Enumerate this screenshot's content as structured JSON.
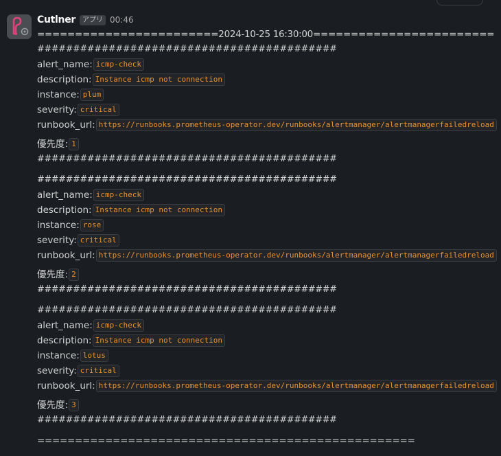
{
  "message": {
    "sender": "Cutlner",
    "app_tag": "アプリ",
    "time": "00:46",
    "top_separator": "========================2024-10-25 16:30:00========================",
    "hash_line": "##########################################",
    "bottom_separator": "==================================================",
    "alerts": [
      {
        "alert_name_label": "alert_name:",
        "alert_name": "icmp-check",
        "description_label": "description:",
        "description": "Instance icmp not connection",
        "instance_label": "instance:",
        "instance": "plum",
        "severity_label": "severity:",
        "severity": "critical",
        "runbook_label": "runbook_url:",
        "runbook_url": "https://runbooks.prometheus-operator.dev/runbooks/alertmanager/alertmanagerfailedreload",
        "priority_label": "優先度:",
        "priority": "1"
      },
      {
        "alert_name_label": "alert_name:",
        "alert_name": "icmp-check",
        "description_label": "description:",
        "description": "Instance icmp not connection",
        "instance_label": "instance:",
        "instance": "rose",
        "severity_label": "severity:",
        "severity": "critical",
        "runbook_label": "runbook_url:",
        "runbook_url": "https://runbooks.prometheus-operator.dev/runbooks/alertmanager/alertmanagerfailedreload",
        "priority_label": "優先度:",
        "priority": "2"
      },
      {
        "alert_name_label": "alert_name:",
        "alert_name": "icmp-check",
        "description_label": "description:",
        "description": "Instance icmp not connection",
        "instance_label": "instance:",
        "instance": "lotus",
        "severity_label": "severity:",
        "severity": "critical",
        "runbook_label": "runbook_url:",
        "runbook_url": "https://runbooks.prometheus-operator.dev/runbooks/alertmanager/alertmanagerfailedreload",
        "priority_label": "優先度:",
        "priority": "3"
      }
    ]
  },
  "colors": {
    "background": "#1a1d21",
    "code_text": "#e8912d",
    "text": "#d1d2d3"
  }
}
